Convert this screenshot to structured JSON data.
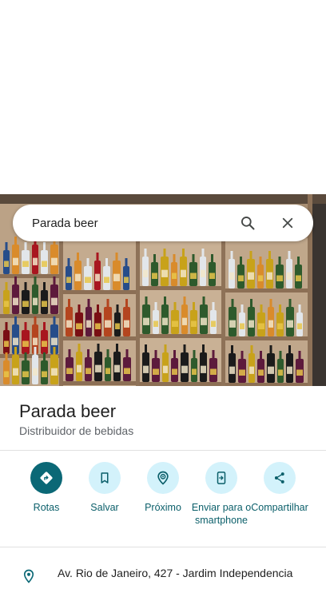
{
  "search": {
    "query": "Parada beer",
    "search_icon": "search-icon",
    "close_icon": "close-icon"
  },
  "place": {
    "title": "Parada beer",
    "category": "Distribuidor de bebidas"
  },
  "photo": {
    "subject": "store-photo"
  },
  "actions": [
    {
      "label": "Rotas",
      "icon": "directions-icon"
    },
    {
      "label": "Salvar",
      "icon": "bookmark-icon"
    },
    {
      "label": "Próximo",
      "icon": "nearby-icon"
    },
    {
      "label": "Enviar para o smartphone",
      "icon": "send-to-phone-icon"
    },
    {
      "label": "Compartilhar",
      "icon": "share-icon"
    }
  ],
  "address": {
    "text": "Av. Rio de Janeiro, 427 - Jardim Independencia",
    "icon": "location-pin-icon"
  },
  "colors": {
    "accent": "#0b6876",
    "accent_light": "#d3f2fb",
    "label": "#0b5f6a"
  }
}
